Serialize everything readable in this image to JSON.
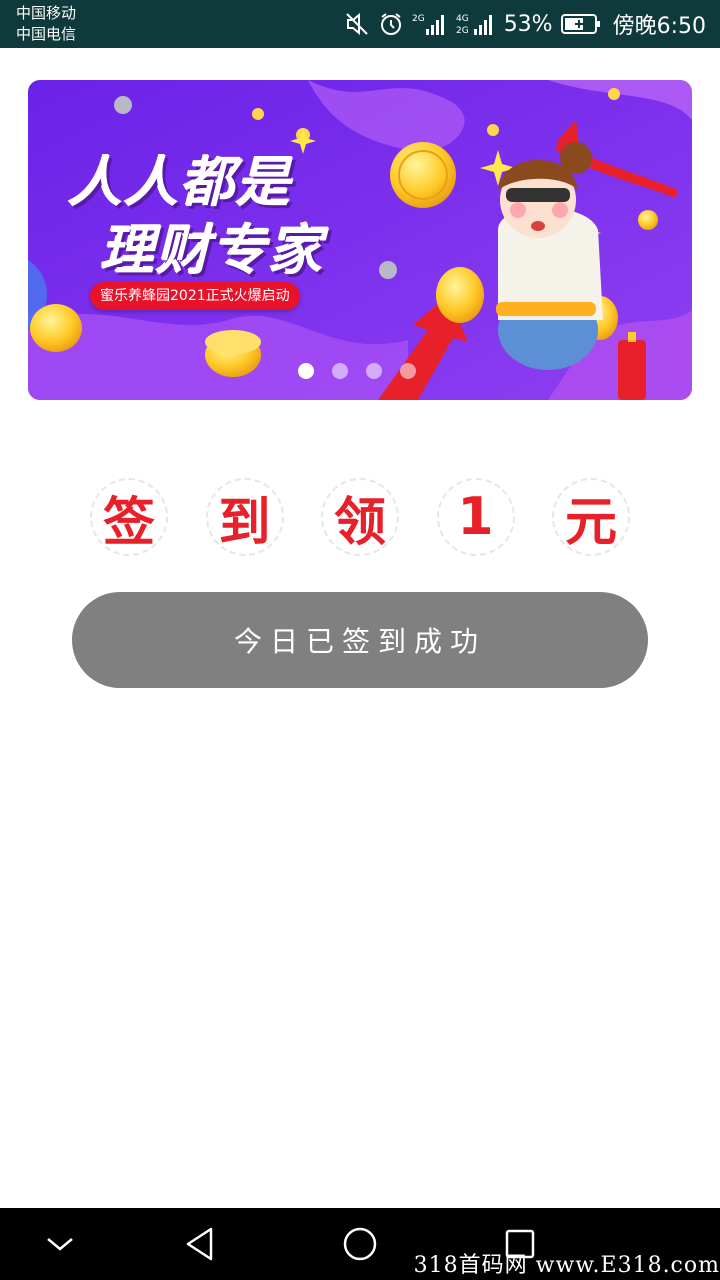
{
  "status_bar": {
    "carrier_1": "中国移动",
    "carrier_2": "中国电信",
    "network_1": "2G",
    "network_2": "4G",
    "battery": "53%",
    "time": "傍晚6:50",
    "icons": [
      "mute-icon",
      "alarm-icon",
      "signal-icon",
      "signal-icon",
      "battery-charging-icon"
    ]
  },
  "banner": {
    "headline_1": "人人都是",
    "headline_2": "理财专家",
    "tagline": "蜜乐养蜂园2021正式火爆启动",
    "slide_count": 4,
    "active_slide": 1
  },
  "sign_in": {
    "chars": [
      "签",
      "到",
      "领",
      "1",
      "元"
    ]
  },
  "button": {
    "label": "今日已签到成功"
  },
  "watermark": "318首码网 www.E318.com",
  "colors": {
    "status_bar_bg": "#0f3a3c",
    "accent_red": "#e8202a",
    "button_gray": "#808080",
    "banner_purple": "#7a2ff0"
  }
}
